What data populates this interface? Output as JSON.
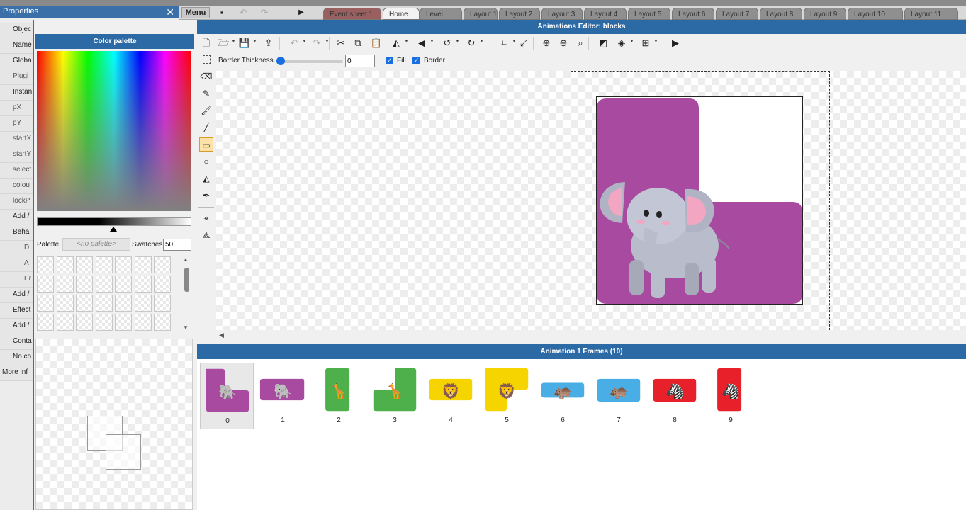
{
  "ide": {
    "properties_title": "Properties",
    "menu_label": "Menu",
    "property_rows": [
      "Objec",
      "Name",
      "Globa",
      "Plugi",
      "Instan",
      "pX",
      "pY",
      "startX",
      "startY",
      "select",
      "colou",
      "lockP",
      "Add /",
      "Beha",
      "D",
      "A",
      "Er",
      "Add /",
      "Effect",
      "Add /",
      "Conta",
      "No co",
      "More inf"
    ],
    "tabs": [
      "Event sheet 1",
      "Home",
      "Level",
      "Layout 1",
      "Layout 2",
      "Layout 3",
      "Layout 4",
      "Layout 5",
      "Layout 6",
      "Layout 7",
      "Layout 8",
      "Layout 9",
      "Layout 10",
      "Layout 11"
    ]
  },
  "editor": {
    "title": "Animations Editor: blocks",
    "color_palette_title": "Color palette",
    "palette_label": "Palette",
    "palette_placeholder": "<no palette>",
    "swatches_label": "Swatches",
    "swatches_value": "50",
    "border_thickness_label": "Border Thickness",
    "border_thickness_value": "0",
    "border_thickness_level": 0,
    "fill_label": "Fill",
    "fill_checked": true,
    "border_label": "Border",
    "border_checked": true,
    "toolbar_icons": [
      "new-icon",
      "open-icon",
      "save-icon",
      "export-icon",
      "undo-icon",
      "redo-icon",
      "cut-icon",
      "copy-icon",
      "paste-icon",
      "flip-horizontal-icon",
      "flip-vertical-icon",
      "rotate-ccw-icon",
      "rotate-cw-icon",
      "crop-icon",
      "resize-icon",
      "zoom-in-icon",
      "zoom-out-icon",
      "zoom-reset-icon",
      "color-mode-icon",
      "layers-icon",
      "grid-icon",
      "play-icon"
    ],
    "tools": [
      "eraser-tool",
      "pencil-tool",
      "brush-tool",
      "line-tool",
      "rectangle-tool",
      "ellipse-tool",
      "fill-tool",
      "color-picker-tool",
      "origin-tool",
      "image-points-tool"
    ],
    "active_tool": "rectangle-tool"
  },
  "frames": {
    "title": "Animation 1 Frames (10)",
    "selected_index": 0,
    "items": [
      {
        "number": "0",
        "animal": "elephant",
        "color": "#a84aa0"
      },
      {
        "number": "1",
        "animal": "elephant",
        "color": "#a84aa0"
      },
      {
        "number": "2",
        "animal": "giraffe",
        "color": "#4db04a"
      },
      {
        "number": "3",
        "animal": "giraffe",
        "color": "#4db04a"
      },
      {
        "number": "4",
        "animal": "lion",
        "color": "#f5d400"
      },
      {
        "number": "5",
        "animal": "lion",
        "color": "#f5d400"
      },
      {
        "number": "6",
        "animal": "hippo",
        "color": "#4aaee6"
      },
      {
        "number": "7",
        "animal": "hippo",
        "color": "#4aaee6"
      },
      {
        "number": "8",
        "animal": "zebra",
        "color": "#e8202a"
      },
      {
        "number": "9",
        "animal": "zebra",
        "color": "#e8202a"
      }
    ]
  },
  "colors": {
    "accent": "#2c6aa6",
    "block_purple": "#a84aa0",
    "block_green": "#4db04a",
    "block_yellow": "#f5d400",
    "block_blue": "#4aaee6",
    "block_red": "#e8202a"
  }
}
